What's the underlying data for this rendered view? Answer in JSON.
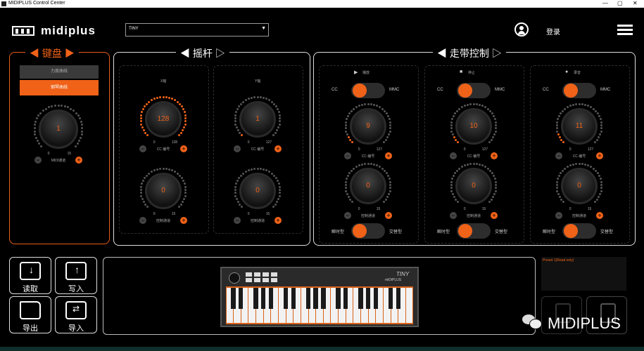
{
  "window": {
    "title": "MIDIPLUS Control Center",
    "controls": [
      "—",
      "▢",
      "✕"
    ]
  },
  "header": {
    "logo": "midiplus",
    "device_select": "TINY",
    "login": "登录"
  },
  "keyboard": {
    "title": "键盘",
    "curve_buttons": [
      "力度曲线",
      "钢琴曲线"
    ],
    "knob": {
      "value": "1",
      "min": "0",
      "max": "15",
      "label": "MIDI通道",
      "fill": 0.0
    }
  },
  "joystick": {
    "title": "摇杆",
    "columns": [
      {
        "axis": "X轴",
        "cc": {
          "value": "128",
          "min": "0",
          "max": "128",
          "label": "CC 编号",
          "fill": 1.0
        },
        "channel": {
          "value": "0",
          "min": "0",
          "max": "15",
          "label": "控制通道",
          "fill": 0.0
        }
      },
      {
        "axis": "Y轴",
        "cc": {
          "value": "1",
          "min": "0",
          "max": "127",
          "label": "CC 编号",
          "fill": 0.01
        },
        "channel": {
          "value": "0",
          "min": "0",
          "max": "15",
          "label": "控制通道",
          "fill": 0.0
        }
      }
    ]
  },
  "transport": {
    "title": "走带控制",
    "columns": [
      {
        "icon_name": "play-icon",
        "icon": "▶",
        "label": "播放",
        "toggle_left": "CC",
        "toggle_right": "MMC",
        "toggle_on_left": true,
        "cc": {
          "value": "9",
          "min": "0",
          "max": "127",
          "label": "CC 编号",
          "fill": 0.07
        },
        "channel": {
          "value": "0",
          "min": "0",
          "max": "15",
          "label": "控制通道",
          "fill": 0.0
        },
        "mode_left": "瞬时型",
        "mode_right": "交替型"
      },
      {
        "icon_name": "stop-icon",
        "icon": "■",
        "label": "停止",
        "toggle_left": "CC",
        "toggle_right": "MMC",
        "toggle_on_left": true,
        "cc": {
          "value": "10",
          "min": "0",
          "max": "127",
          "label": "CC 编号",
          "fill": 0.08
        },
        "channel": {
          "value": "0",
          "min": "0",
          "max": "15",
          "label": "控制通道",
          "fill": 0.0
        },
        "mode_left": "瞬时型",
        "mode_right": "交替型"
      },
      {
        "icon_name": "record-icon",
        "icon": "●",
        "label": "录音",
        "toggle_left": "CC",
        "toggle_right": "MMC",
        "toggle_on_left": true,
        "cc": {
          "value": "11",
          "min": "0",
          "max": "127",
          "label": "CC 编号",
          "fill": 0.09
        },
        "channel": {
          "value": "0",
          "min": "0",
          "max": "15",
          "label": "控制通道",
          "fill": 0.0
        },
        "mode_left": "瞬时型",
        "mode_right": "交替型"
      }
    ]
  },
  "actions": {
    "read": "读取",
    "write": "写入",
    "export": "导出",
    "import": "导入"
  },
  "device_image": {
    "brand": "miDiPLUS",
    "model": "TINY"
  },
  "preset": {
    "label": "Preset 1(Read only)"
  },
  "watermark": {
    "text": "MIDIPLUS"
  },
  "colors": {
    "accent": "#f06218",
    "panel_border": "#dddddd",
    "background": "#000000"
  }
}
